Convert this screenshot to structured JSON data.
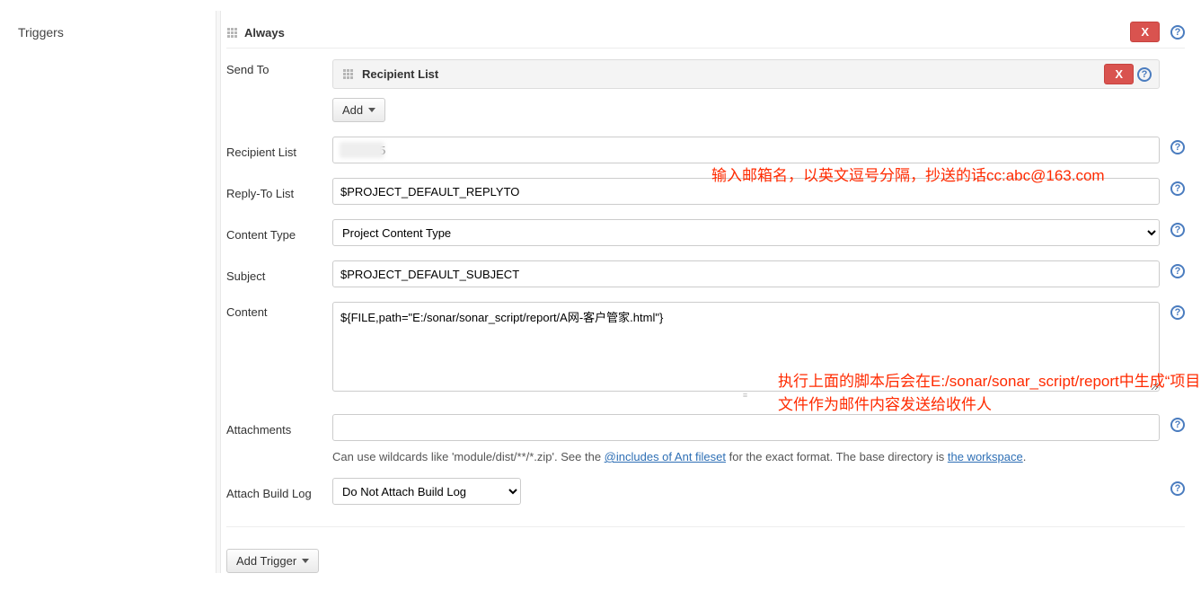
{
  "sidebar": {
    "triggers": "Triggers"
  },
  "section": {
    "title": "Always",
    "close": "X",
    "send_to": {
      "label": "Send To",
      "recipient_list_title": "Recipient List",
      "close": "X",
      "add": "Add"
    },
    "recipient_list": {
      "label": "Recipient List",
      "value": "5"
    },
    "reply_to": {
      "label": "Reply-To List",
      "value": "$PROJECT_DEFAULT_REPLYTO"
    },
    "content_type": {
      "label": "Content Type",
      "value": "Project Content Type"
    },
    "subject": {
      "label": "Subject",
      "value": "$PROJECT_DEFAULT_SUBJECT"
    },
    "content": {
      "label": "Content",
      "value": "${FILE,path=\"E:/sonar/sonar_script/report/A网-客户管家.html\"}"
    },
    "attachments": {
      "label": "Attachments",
      "value": ""
    },
    "attachments_hint": {
      "pre": "Can use wildcards like 'module/dist/**/*.zip'. See the ",
      "link1": "@includes of Ant fileset",
      "mid": " for the exact format. The base directory is ",
      "link2": "the workspace",
      "post": "."
    },
    "attach_log": {
      "label": "Attach Build Log",
      "value": "Do Not Attach Build Log"
    }
  },
  "footer": {
    "add_trigger": "Add Trigger"
  },
  "annotations": {
    "a1": "输入邮箱名，以英文逗号分隔，抄送的话cc:abc@163.com",
    "a2": "执行上面的脚本后会在E:/sonar/sonar_script/report中生成“项目名.html”的文件，以此文件作为邮件内容发送给收件人"
  }
}
